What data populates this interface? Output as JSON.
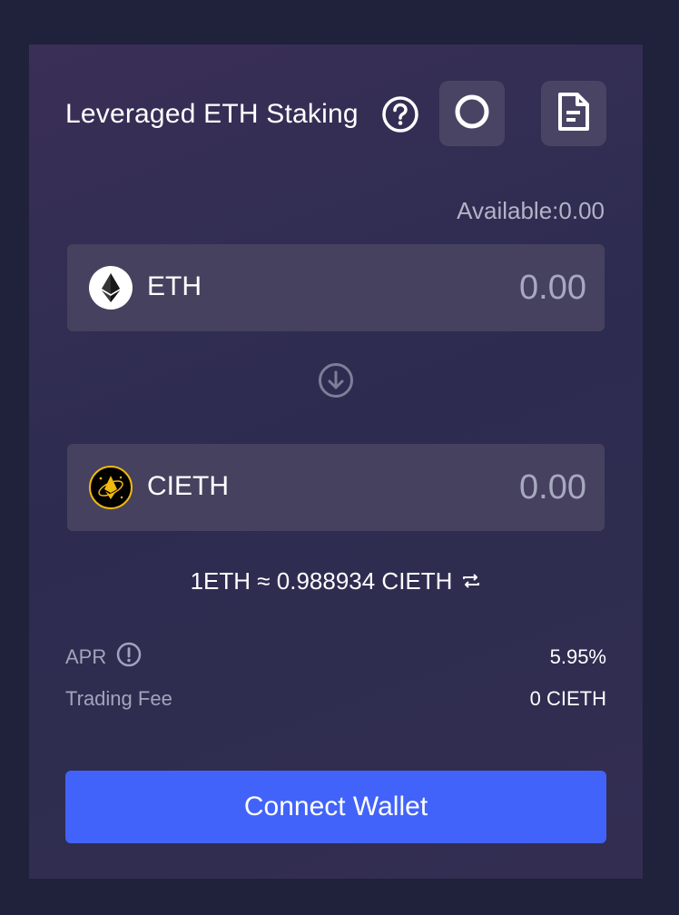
{
  "header": {
    "title": "Leveraged ETH Staking",
    "help_icon": "question-circle-icon",
    "refresh_icon": "refresh-ring-icon",
    "doc_icon": "document-icon"
  },
  "balance": {
    "label": "Available:",
    "value": "0.00"
  },
  "from_token": {
    "symbol": "ETH",
    "logo": "ethereum-logo",
    "placeholder": "0.00"
  },
  "swap_arrow": "arrow-down-circle-icon",
  "to_token": {
    "symbol": "CIETH",
    "logo": "cieth-logo",
    "placeholder": "0.00"
  },
  "rate": {
    "text": "1ETH ≈ 0.988934 CIETH",
    "icon": "swap-arrows-icon"
  },
  "info": {
    "apr_label": "APR",
    "apr_icon": "info-circle-icon",
    "apr_value": "5.95%",
    "fee_label": "Trading Fee",
    "fee_value": "0 CIETH"
  },
  "actions": {
    "connect_label": "Connect Wallet"
  },
  "colors": {
    "page_bg": "#20213a",
    "card_bg": "#332e54",
    "input_bg": "#46415f",
    "icon_button_bg": "#4a4464",
    "accent": "#4263fa",
    "muted_text": "#a3a4bb",
    "cieth_gold": "#f0b90b"
  }
}
